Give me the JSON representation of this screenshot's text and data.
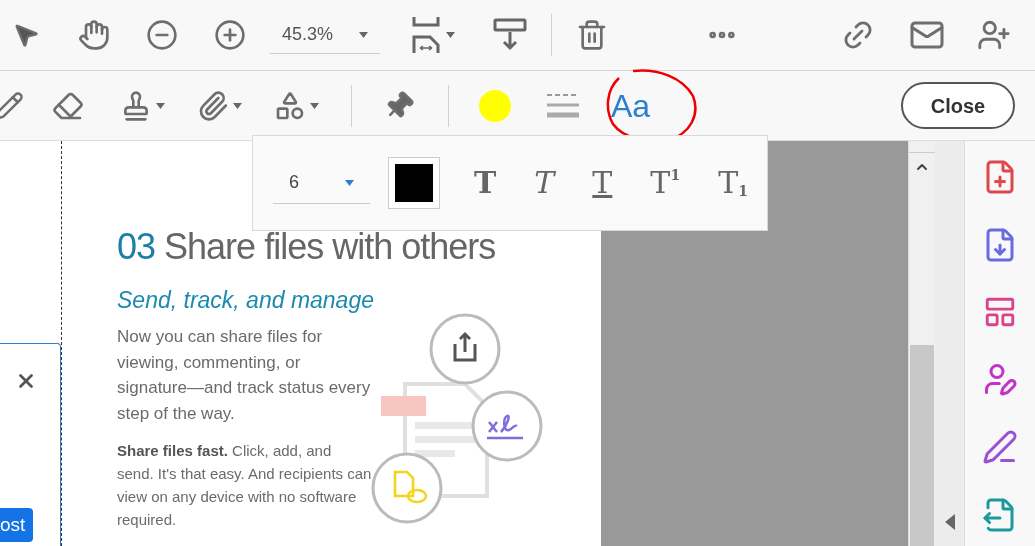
{
  "toolbar": {
    "zoom": {
      "value": "45.3%"
    }
  },
  "comment_toolbar": {
    "text_tool": {
      "label": "Aa",
      "selected": true
    },
    "highlight": {
      "color": "#ffff00"
    },
    "close_button": "Close"
  },
  "text_format_popover": {
    "font_size": "6",
    "color": "#000000",
    "styles": [
      {
        "kind": "bold",
        "label": "T",
        "selected": false
      },
      {
        "kind": "italic",
        "label": "T",
        "selected": false
      },
      {
        "kind": "underline",
        "label": "T",
        "selected": false
      },
      {
        "kind": "superscript",
        "label": "T",
        "mark": "1",
        "selected": false
      },
      {
        "kind": "subscript",
        "label": "T",
        "mark": "1",
        "selected": false
      }
    ]
  },
  "side_card": {
    "button": "ost"
  },
  "document": {
    "number": "03",
    "heading": "Share files with others",
    "subheading": "Send, track, and manage",
    "paragraphs": [
      "Now you can share files for viewing, commenting, or signature—and track status every step of the way.",
      "**Share files fast.** Click, add, and send. It's that easy. And recipients can view on any device with no software required."
    ]
  }
}
